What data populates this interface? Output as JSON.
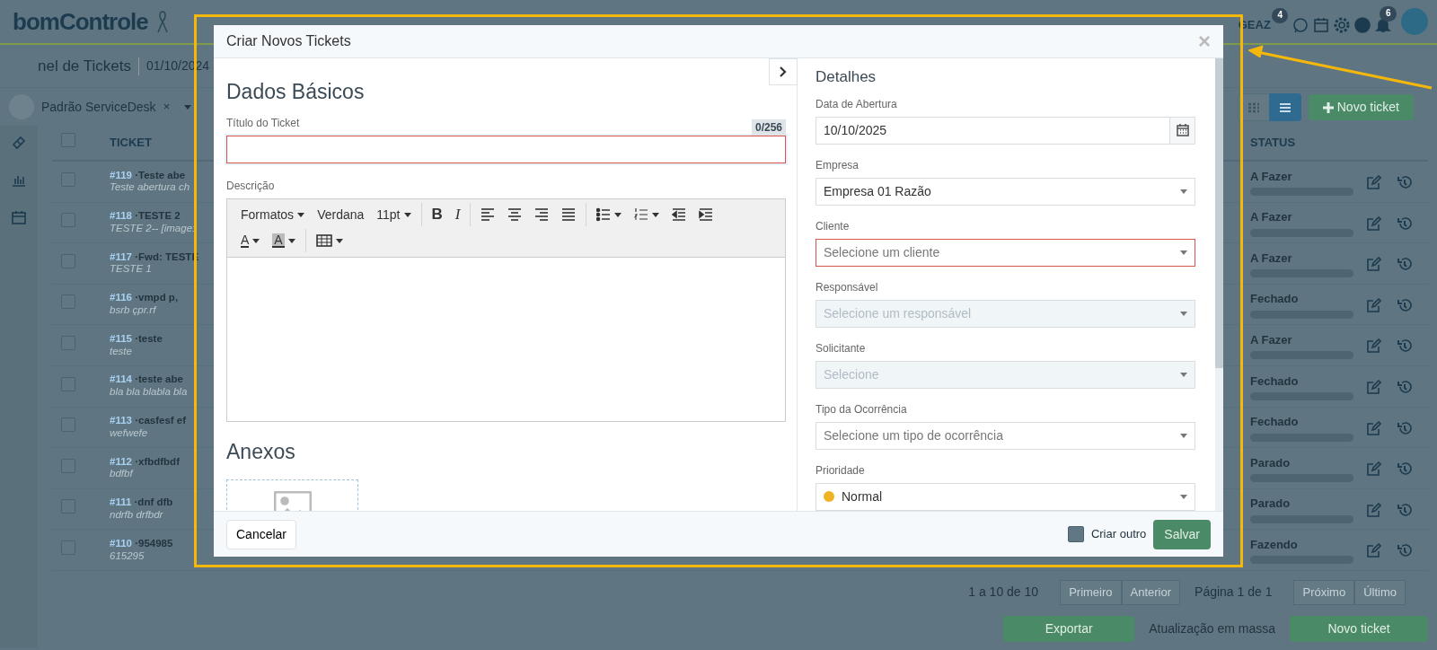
{
  "navbar": {
    "logo": "bomControle",
    "user_label": "GEAZ",
    "message_count": "4",
    "notification_count": "6"
  },
  "subheader": {
    "title": "nel de Tickets",
    "date": "01/10/2024"
  },
  "filter": {
    "name": "Padrão ServiceDesk",
    "remove": "×"
  },
  "view_modes": [
    {
      "kind": "grid",
      "selected": false
    },
    {
      "kind": "list",
      "selected": true
    }
  ],
  "new_ticket_button": "Novo ticket",
  "table": {
    "columns": [
      "TICKET",
      "STATUS"
    ],
    "select_all": {
      "checked": false
    },
    "rows": [
      {
        "number": "#119",
        "title": "·Teste abe",
        "subtitle": "Teste abertura ch",
        "status": "A Fazer",
        "level": 0,
        "checked": false
      },
      {
        "number": "#118",
        "title": "·TESTE 2",
        "subtitle": "TESTE 2-- [image:",
        "status": "A Fazer",
        "level": 0,
        "checked": false
      },
      {
        "number": "#117",
        "title": "·Fwd: TESTE",
        "subtitle": "TESTE 1",
        "status": "A Fazer",
        "level": 0,
        "checked": false
      },
      {
        "number": "#116",
        "title": "·vmpd p,",
        "subtitle": "bsrb çpr.rf",
        "status": "Fechado",
        "level": 0,
        "checked": false
      },
      {
        "number": "#115",
        "title": "·teste",
        "subtitle": "teste",
        "status": "A Fazer",
        "level": 0,
        "checked": false
      },
      {
        "number": "#114",
        "title": "·teste abe",
        "subtitle": "bla bla blabla bla",
        "status": "Fechado",
        "level": 0,
        "checked": false
      },
      {
        "number": "#113",
        "title": "·casfesf ef",
        "subtitle": "wefwefe",
        "status": "Fechado",
        "level": 0,
        "checked": false
      },
      {
        "number": "#112",
        "title": "·xfbdfbdf",
        "subtitle": "bdfbf",
        "status": "Parado",
        "level": 0,
        "checked": false
      },
      {
        "number": "#111",
        "title": "·dnf dfb",
        "subtitle": "ndrfb drfbdr",
        "status": "Parado",
        "level": 0,
        "checked": false
      },
      {
        "number": "#110",
        "title": "·954985",
        "subtitle": "615295",
        "status": "Fazendo",
        "level": 0,
        "checked": false
      }
    ]
  },
  "pagination": {
    "summary": "1 a 10 de 10",
    "first": [
      "Primeiro",
      "Anterior"
    ],
    "page": "Página 1 de 1",
    "last": [
      "Próximo",
      "Último"
    ]
  },
  "footer_actions": {
    "export": "Exportar",
    "bulk": "Atualização em massa",
    "new": "Novo ticket"
  },
  "modal": {
    "title": "Criar Novos Tickets",
    "close": "×",
    "basic": {
      "heading": "Dados Básicos",
      "title_label": "Título do Ticket",
      "counter": "0/256",
      "title_invalid": true,
      "description_label": "Descrição",
      "toolbar_rows": [
        [
          [
            {
              "kind": "dropdown",
              "label": "Formatos"
            },
            {
              "kind": "plain",
              "label": "Verdana"
            },
            {
              "kind": "dropdown",
              "label": "11pt"
            }
          ],
          [
            {
              "kind": "bold",
              "label": "B"
            },
            {
              "kind": "italic",
              "label": "I"
            }
          ],
          [
            {
              "kind": "align-left"
            },
            {
              "kind": "align-center"
            },
            {
              "kind": "align-right"
            },
            {
              "kind": "align-justify"
            }
          ],
          [
            {
              "kind": "bullet-list"
            },
            {
              "kind": "numbered-list"
            },
            {
              "kind": "outdent"
            },
            {
              "kind": "indent"
            }
          ]
        ],
        [
          [
            {
              "kind": "text-color",
              "label": "A"
            },
            {
              "kind": "background-color",
              "label": "A"
            }
          ],
          [
            {
              "kind": "table"
            }
          ]
        ]
      ],
      "attachments_heading": "Anexos"
    },
    "details": {
      "heading": "Detalhes",
      "fields": [
        {
          "kind": "date",
          "label": "Data de Abertura",
          "value": "10/10/2025",
          "invalid": false,
          "disabled": false
        },
        {
          "kind": "select",
          "label": "Empresa",
          "value": "Empresa 01 Razão",
          "invalid": false,
          "disabled": false
        },
        {
          "kind": "select",
          "label": "Cliente",
          "placeholder": "Selecione um cliente",
          "invalid": true,
          "disabled": false
        },
        {
          "kind": "select",
          "label": "Responsável",
          "placeholder": "Selecione um responsável",
          "invalid": false,
          "disabled": true
        },
        {
          "kind": "select",
          "label": "Solicitante",
          "placeholder": "Selecione",
          "invalid": false,
          "disabled": true
        },
        {
          "kind": "select",
          "label": "Tipo da Ocorrência",
          "placeholder": "Selecione um tipo de ocorrência",
          "invalid": false,
          "disabled": false
        },
        {
          "kind": "select",
          "label": "Prioridade",
          "value": "Normal",
          "color": "#f0b323",
          "invalid": false,
          "disabled": false
        }
      ]
    },
    "cancel": "Cancelar",
    "create_another": {
      "label": "Criar outro",
      "checked": false
    },
    "save": "Salvar"
  }
}
